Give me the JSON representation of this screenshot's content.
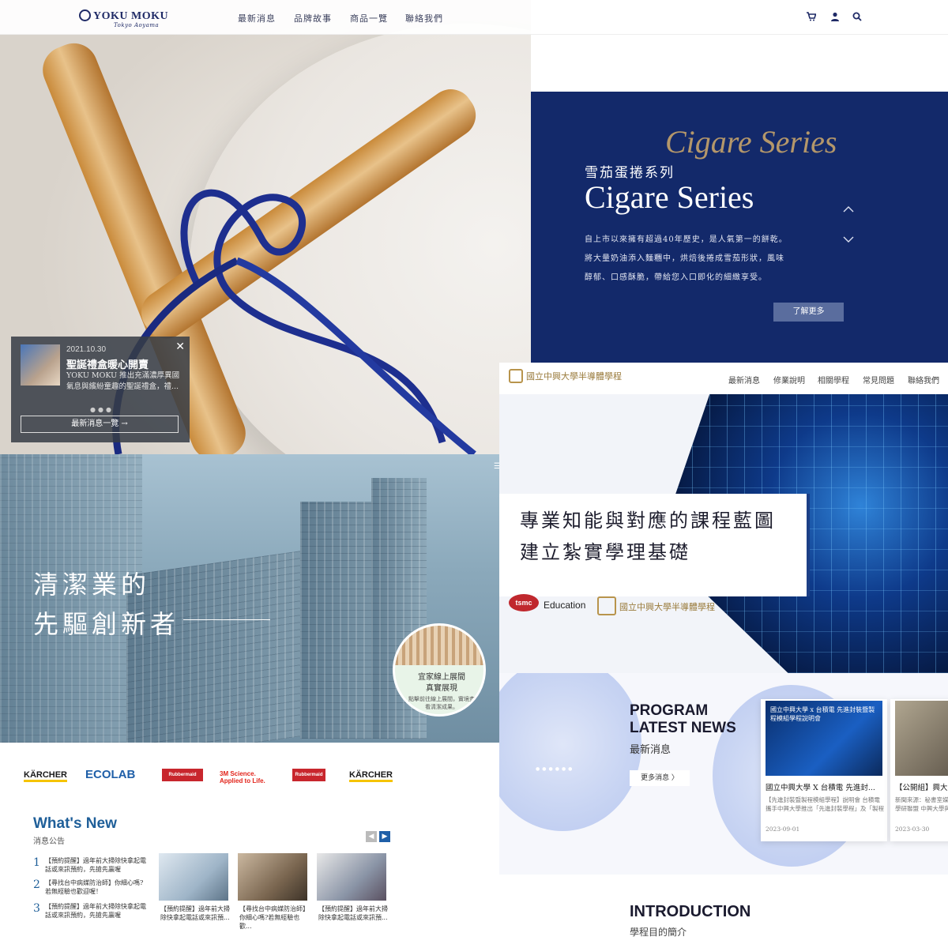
{
  "yoku": {
    "logo_text": "YOKU MOKU",
    "logo_sub": "Tokyo Aoyama",
    "nav": [
      "最新消息",
      "品牌故事",
      "商品一覽",
      "聯絡我們"
    ],
    "news_card": {
      "date": "2021.10.30",
      "title": "聖誕禮盒暖心開賣",
      "text": "YOKU MOKU 推出充滿濃厚異國氣息與繽紛童趣的聖誕禮盒，禮...",
      "button": "最新消息一覽 →"
    }
  },
  "cigare": {
    "script": "Cigare Series",
    "subtitle": "雪茄蛋捲系列",
    "title": "Cigare Series",
    "desc": [
      "自上市以來擁有超過40年歷史，是人氣第一的餅乾。",
      "將大量奶油添入麵糰中，烘焙後捲成雪茄形狀，風味",
      "醇郁、口感酥脆，帶給您入口即化的細緻享受。"
    ],
    "button": "了解更多"
  },
  "clean": {
    "title_line1": "清潔業的",
    "title_line2": "先驅創新者",
    "bubble_title1": "宜家線上展間",
    "bubble_title2": "真實展現",
    "bubble_text": "點擊前往線上展間，實境查看清潔成果。",
    "brands": [
      {
        "name": "KÄRCHER",
        "color": "#1a1a1a"
      },
      {
        "name": "ECOLAB",
        "color": "#1f5fa8"
      },
      {
        "name": "Rubbermaid",
        "color": "#c8262d"
      },
      {
        "name": "3M Science. Applied to Life.",
        "color": "#e2231a"
      },
      {
        "name": "Rubbermaid",
        "color": "#c8262d"
      },
      {
        "name": "KÄRCHER",
        "color": "#1a1a1a"
      }
    ],
    "whats_new_title": "What's New",
    "whats_new_sub": "消息公告",
    "news_list": [
      {
        "num": "1",
        "text": "【預約提醒】過年前大掃除快拿起電話或來訊預約，先搶先贏喔"
      },
      {
        "num": "2",
        "text": "【尋找台中病媒防治師】你細心嗎?若無經驗也歡迎喔！"
      },
      {
        "num": "3",
        "text": "【預約提醒】過年前大掃除快拿起電話或來訊預約，先搶先贏喔"
      }
    ],
    "thumbs": [
      {
        "caption": "【預約提醒】過年前大掃除快拿起電話或來訊預..."
      },
      {
        "caption": "【尋找台中病媒防治師】你細心嗎?若無經驗也歡..."
      },
      {
        "caption": "【預約提醒】過年前大掃除快拿起電話或來訊預..."
      }
    ]
  },
  "nchu": {
    "logo": "國立中興大學半導體學程",
    "nav": [
      "最新消息",
      "修業說明",
      "相關學程",
      "常見問題",
      "聯絡我們"
    ],
    "hero_line1": "專業知能與對應的課程藍圖",
    "hero_line2": "建立紮實學理基礎",
    "tsmc": "tsmc",
    "education": "Education",
    "logo2": "國立中興大學半導體學程",
    "program_line1": "PROGRAM",
    "program_line2": "LATEST NEWS",
    "program_sub": "最新消息",
    "more_button": "更多消息 〉",
    "cards": [
      {
        "title": "國立中興大學 X 台積電 先進封...",
        "text": "【先進封裝暨製程模組學程】說明會 台積電攜手中興大學推出「先進封裝學程」及「製程模組學程」(本學程非教育部學位/學程)...",
        "date": "2023-09-01",
        "banner": "國立中興大學 x 台積電 先進封裝暨製程模組學程說明會"
      },
      {
        "title": "【公開組】興大半導體...",
        "text": "新聞來源：秘書室媒體公關中心 興大半導體學研聯盟 中興大學與台積電合作開設「台積電半導體先進...",
        "date": "2023-03-30",
        "banner": ""
      }
    ],
    "intro_title": "INTRODUCTION",
    "intro_sub": "學程目的簡介"
  }
}
